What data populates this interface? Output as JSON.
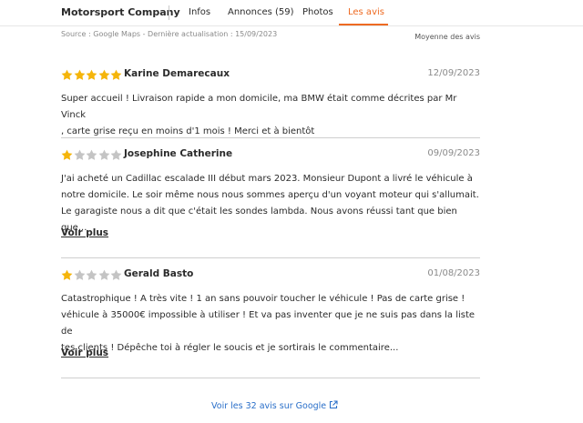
{
  "nav": {
    "brand": "Motorsport Company",
    "tabs": [
      {
        "label": "Infos"
      },
      {
        "label": "Annonces (59)"
      },
      {
        "label": "Photos"
      },
      {
        "label": "Les avis"
      }
    ],
    "active_color": "#ee6a22"
  },
  "source_line": "Source : Google Maps - Dernière actualisation : 15/09/2023",
  "average_label": "Moyenne des avis",
  "colors": {
    "star_filled": "#f5b50a",
    "star_empty": "#c4c4c4",
    "link": "#2a6fc9"
  },
  "reviews": [
    {
      "rating": 5,
      "author": "Karine Demarecaux",
      "date": "12/09/2023",
      "text_lines": [
        "Super accueil ! Livraison rapide a mon domicile, ma BMW était comme décrites par Mr Vinck",
        ", carte grise reçu en moins d'1 mois ! Merci et à bientôt"
      ]
    },
    {
      "rating": 1,
      "author": "Josephine Catherine",
      "date": "09/09/2023",
      "text_lines": [
        "J'ai acheté un Cadillac escalade III début mars 2023. Monsieur Dupont a livré le véhicule à",
        "notre domicile. Le soir même nous nous sommes aperçu d'un voyant moteur qui s'allumait.",
        "Le garagiste nous a dit que c'était les sondes lambda. Nous avons réussi tant que bien que..."
      ],
      "more_label": "Voir plus"
    },
    {
      "rating": 1,
      "author": "Gerald Basto",
      "date": "01/08/2023",
      "text_lines": [
        "Catastrophique ! A très vite ! 1 an sans pouvoir toucher le véhicule ! Pas de carte grise !",
        "véhicule à 35000€ impossible à utiliser ! Et va pas inventer que je ne suis pas dans la liste de",
        "tes clients ! Dépêche toi à régler le soucis et je sortirais le commentaire..."
      ],
      "more_label": "Voir plus"
    }
  ],
  "all_reviews_link": "Voir les 32 avis sur Google",
  "icons": {
    "star": "star-icon",
    "external": "external-link-icon"
  }
}
